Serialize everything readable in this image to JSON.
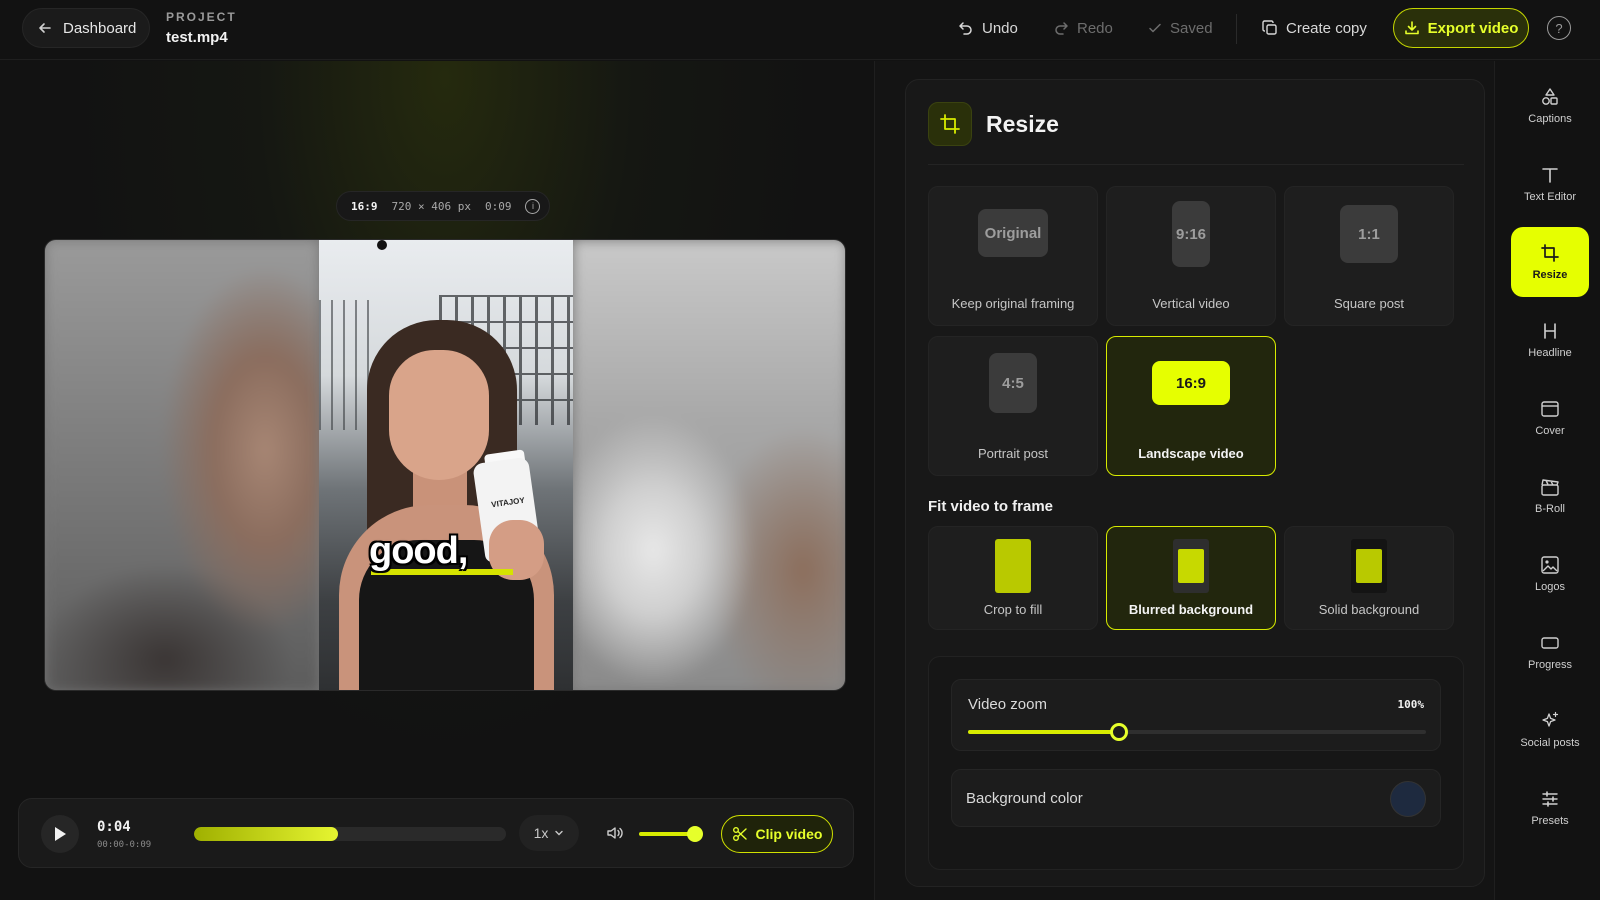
{
  "topbar": {
    "back_label": "Dashboard",
    "project_kicker": "PROJECT",
    "project_name": "test.mp4",
    "undo_label": "Undo",
    "redo_label": "Redo",
    "saved_label": "Saved",
    "copy_label": "Create copy",
    "export_label": "Export video",
    "help_icon": "?"
  },
  "preview": {
    "ratio": "16:9",
    "dimensions": "720 × 406 px",
    "duration": "0:09",
    "info_icon": "i",
    "caption_word": "good,",
    "product_label": "VITAJOY"
  },
  "player": {
    "current_time": "0:04",
    "range": "00:00-0:09",
    "progress": 0.46,
    "speed": "1x",
    "volume": 0.93,
    "clip_label": "Clip video"
  },
  "panel": {
    "title": "Resize",
    "formats": [
      {
        "badge": "Original",
        "label": "Keep original framing",
        "active": false
      },
      {
        "badge": "9:16",
        "label": "Vertical video",
        "active": false
      },
      {
        "badge": "1:1",
        "label": "Square post",
        "active": false
      },
      {
        "badge": "4:5",
        "label": "Portrait post",
        "active": false
      },
      {
        "badge": "16:9",
        "label": "Landscape video",
        "active": true
      }
    ],
    "fit_title": "Fit video to frame",
    "fit_options": [
      {
        "label": "Crop to fill",
        "active": false
      },
      {
        "label": "Blurred background",
        "active": true
      },
      {
        "label": "Solid background",
        "active": false
      }
    ],
    "zoom_label": "Video zoom",
    "zoom_value": "100%",
    "zoom_level": 0.33,
    "bg_color_label": "Background color",
    "bg_color": "#1e2a3f"
  },
  "rail": [
    {
      "label": "Captions",
      "icon": "shapes-icon",
      "active": false
    },
    {
      "label": "Text Editor",
      "icon": "text-icon",
      "active": false
    },
    {
      "label": "Resize",
      "icon": "crop-icon",
      "active": true
    },
    {
      "label": "Headline",
      "icon": "heading-icon",
      "active": false
    },
    {
      "label": "Cover",
      "icon": "cover-icon",
      "active": false
    },
    {
      "label": "B-Roll",
      "icon": "clapper-icon",
      "active": false
    },
    {
      "label": "Logos",
      "icon": "image-icon",
      "active": false
    },
    {
      "label": "Progress",
      "icon": "progress-icon",
      "active": false
    },
    {
      "label": "Social posts",
      "icon": "sparkle-icon",
      "active": false
    },
    {
      "label": "Presets",
      "icon": "sliders-icon",
      "active": false
    }
  ],
  "colors": {
    "accent": "#e6ff00",
    "background": "#121212",
    "panel": "#181818"
  }
}
